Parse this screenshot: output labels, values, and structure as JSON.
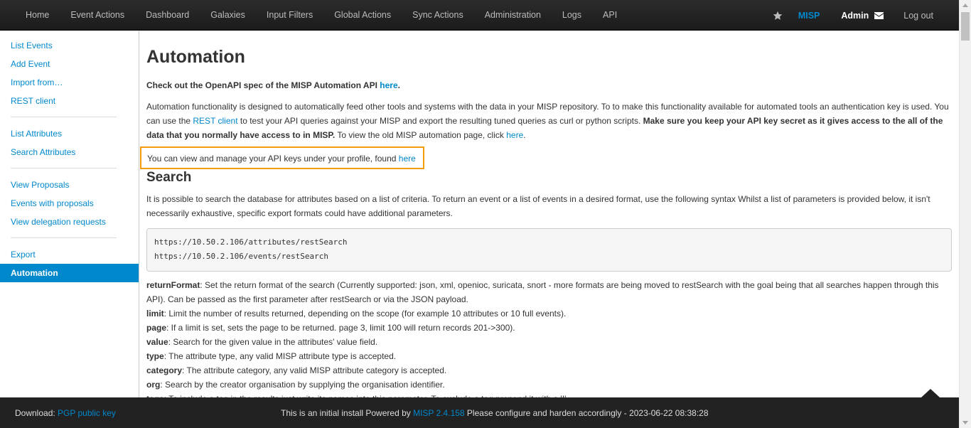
{
  "navbar": {
    "items": [
      "Home",
      "Event Actions",
      "Dashboard",
      "Galaxies",
      "Input Filters",
      "Global Actions",
      "Sync Actions",
      "Administration",
      "Logs",
      "API"
    ],
    "brand": "MISP",
    "user": "Admin",
    "logout": "Log out"
  },
  "sidebar": {
    "groups": [
      [
        "List Events",
        "Add Event",
        "Import from…",
        "REST client"
      ],
      [
        "List Attributes",
        "Search Attributes"
      ],
      [
        "View Proposals",
        "Events with proposals",
        "View delegation requests"
      ],
      [
        "Export",
        "Automation"
      ]
    ],
    "active": "Automation"
  },
  "main": {
    "title": "Automation",
    "openapi_text": "Check out the OpenAPI spec of the MISP Automation API ",
    "openapi_link": "here",
    "openapi_end": ".",
    "intro_1": "Automation functionality is designed to automatically feed other tools and systems with the data in your MISP repository. To to make this functionality available for automated tools an authentication key is used. You can use the ",
    "intro_link": "REST client",
    "intro_2": " to test your API queries against your MISP and export the resulting tuned queries as curl or python scripts. ",
    "intro_bold": "Make sure you keep your API key secret as it gives access to the all of the data that you normally have access to in MISP.",
    "intro_3": " To view the old MISP automation page, click ",
    "intro_link2": "here",
    "intro_end": ".",
    "keys_text": "You can view and manage your API keys under your profile, found ",
    "keys_link": "here",
    "search_heading": "Search",
    "search_desc": "It is possible to search the database for attributes based on a list of criteria. To return an event or a list of events in a desired format, use the following syntax Whilst a list of parameters is provided below, it isn't necessarily exhaustive, specific export formats could have additional parameters.",
    "code_lines": [
      "https://10.50.2.106/attributes/restSearch",
      "https://10.50.2.106/events/restSearch"
    ],
    "params": [
      {
        "name": "returnFormat",
        "desc": ": Set the return format of the search (Currently supported: json, xml, openioc, suricata, snort - more formats are being moved to restSearch with the goal being that all searches happen through this API). Can be passed as the first parameter after restSearch or via the JSON payload."
      },
      {
        "name": "limit",
        "desc": ": Limit the number of results returned, depending on the scope (for example 10 attributes or 10 full events)."
      },
      {
        "name": "page",
        "desc": ": If a limit is set, sets the page to be returned. page 3, limit 100 will return records 201->300)."
      },
      {
        "name": "value",
        "desc": ": Search for the given value in the attributes' value field."
      },
      {
        "name": "type",
        "desc": ": The attribute type, any valid MISP attribute type is accepted."
      },
      {
        "name": "category",
        "desc": ": The attribute category, any valid MISP attribute category is accepted."
      },
      {
        "name": "org",
        "desc": ": Search by the creator organisation by supplying the organisation identifier."
      },
      {
        "name": "tags",
        "desc": ": To include a tag in the results just write its names into this parameter. To exclude a tag prepend it with a '!'."
      }
    ]
  },
  "footer": {
    "download_label": "Download: ",
    "download_link": "PGP public key",
    "center_1": "This is an initial install Powered by ",
    "center_link": "MISP 2.4.158",
    "center_2": " Please configure and harden accordingly - 2023-06-22 08:38:28"
  },
  "colors": {
    "accent": "#0088cc",
    "highlight_border": "#f39c12",
    "navbar": "#1b1b1b"
  },
  "icons": [
    "star-icon",
    "envelope-icon"
  ]
}
